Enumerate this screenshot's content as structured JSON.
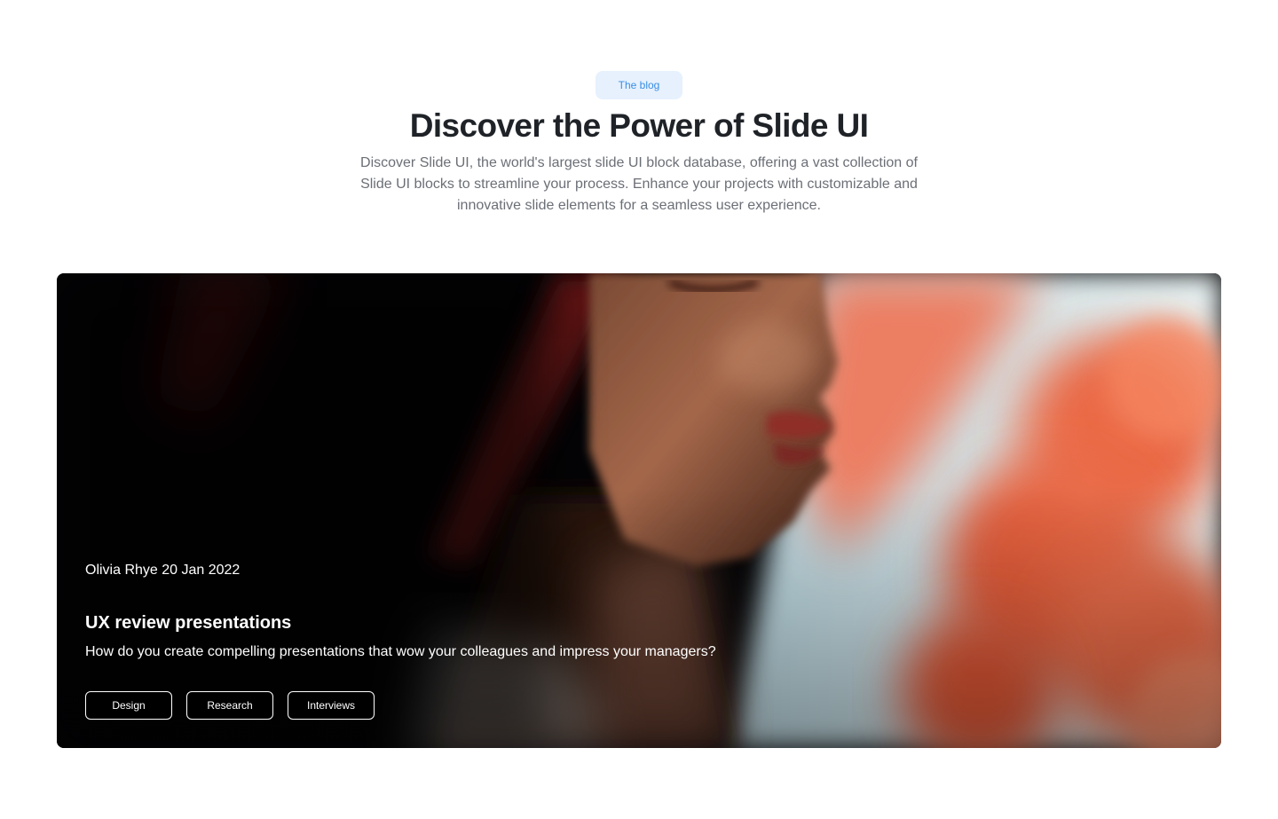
{
  "header": {
    "badge_label": "The blog",
    "title": "Discover the Power of Slide UI",
    "subtitle": "Discover Slide UI, the world's largest slide UI block database, offering a vast collection of Slide UI blocks to streamline your process. Enhance your projects with customizable and innovative slide elements for a seamless user experience."
  },
  "featured_post": {
    "meta": "Olivia Rhye 20 Jan 2022",
    "title": "UX review presentations",
    "description": "How do you create compelling presentations that wow your colleagues and impress your managers?",
    "tags": [
      "Design",
      "Research",
      "Interviews"
    ],
    "image": "portrait-photo-with-coral-flowers"
  },
  "colors": {
    "badge_bg": "#e6f1fd",
    "badge_text": "#3a8ee6",
    "title": "#1f2328",
    "subtitle": "#6b6f76",
    "card_bg": "#050507",
    "card_text": "#ffffff",
    "flower_accent": "#ef6a47"
  }
}
